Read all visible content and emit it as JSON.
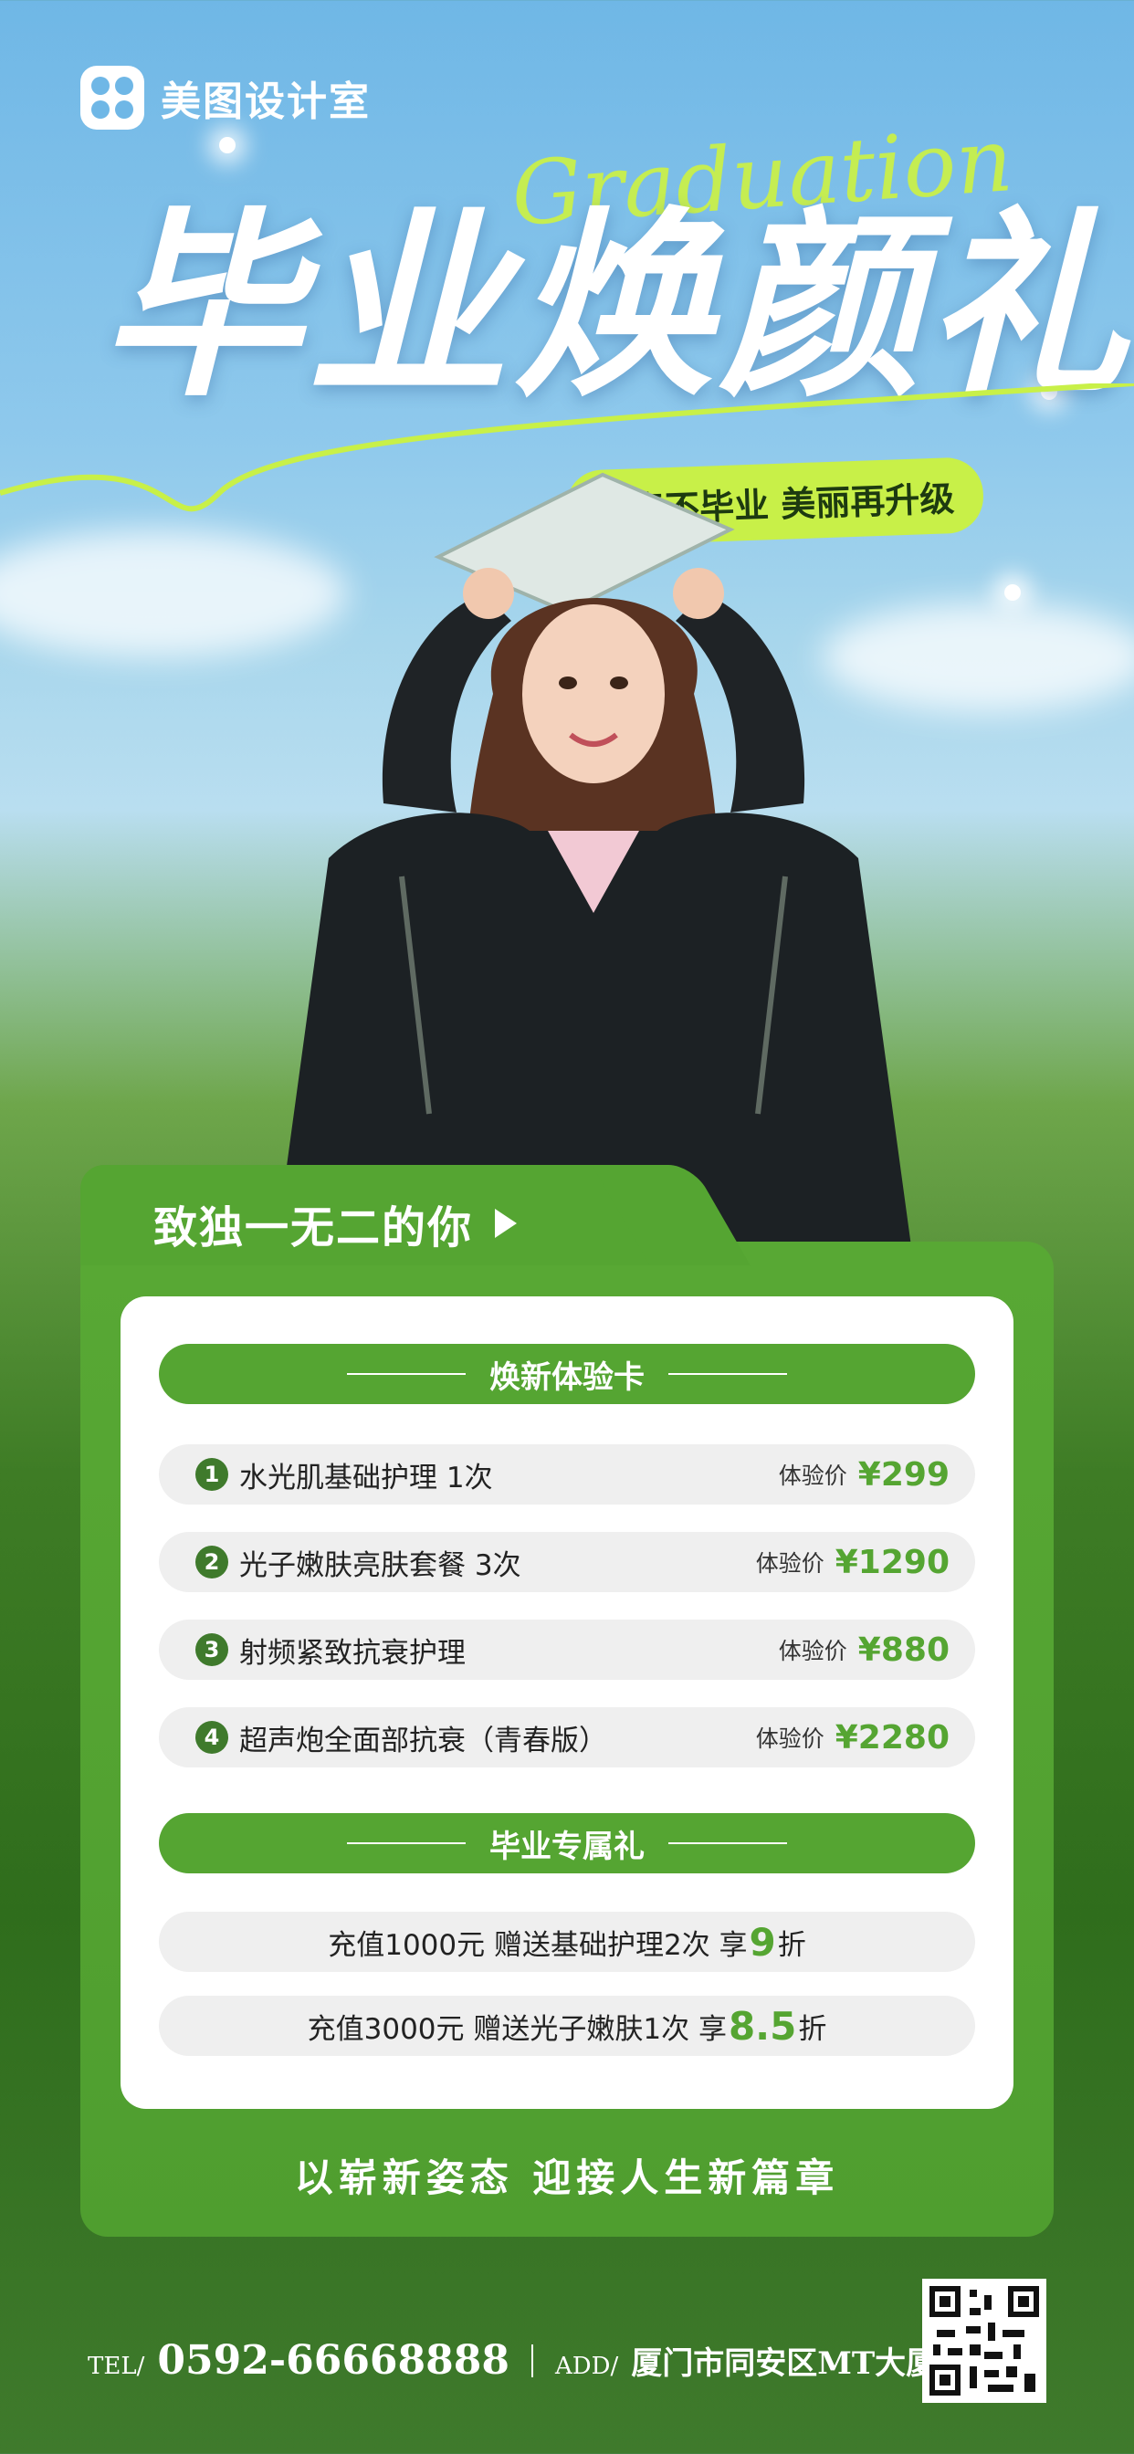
{
  "brand": {
    "logo_text": "美图设计室"
  },
  "hero": {
    "script_title": "Graduation",
    "main_title": "毕业焕颜礼",
    "subtitle": "青春不毕业 美丽再升级"
  },
  "card": {
    "tab_title": "致独一无二的你",
    "section1_title": "焕新体验卡",
    "items": [
      {
        "num": "1",
        "name": "水光肌基础护理 1次",
        "price_label": "体验价",
        "price": "¥299"
      },
      {
        "num": "2",
        "name": "光子嫩肤亮肤套餐 3次",
        "price_label": "体验价",
        "price": "¥1290"
      },
      {
        "num": "3",
        "name": "射频紧致抗衰护理",
        "price_label": "体验价",
        "price": "¥880"
      },
      {
        "num": "4",
        "name": "超声炮全面部抗衰（青春版）",
        "price_label": "体验价",
        "price": "¥2280"
      }
    ],
    "section2_title": "毕业专属礼",
    "gifts": [
      {
        "prefix": "充值1000元 赠送基础护理2次 享",
        "discount": "9",
        "suffix": "折"
      },
      {
        "prefix": "充值3000元 赠送光子嫩肤1次 享",
        "discount": "8.5",
        "suffix": "折"
      }
    ],
    "slogan": "以崭新姿态 迎接人生新篇章"
  },
  "footer": {
    "tel_label": "TEL/",
    "phone": "0592-66668888",
    "addr_label": "ADD/",
    "address": "厦门市同安区MT大厦"
  },
  "colors": {
    "accent_green": "#55a532",
    "lime": "#c8f048",
    "sky": "#6fb7e6"
  },
  "icons": [
    "logo-icon",
    "arrow-right-icon",
    "qr-code-icon"
  ]
}
